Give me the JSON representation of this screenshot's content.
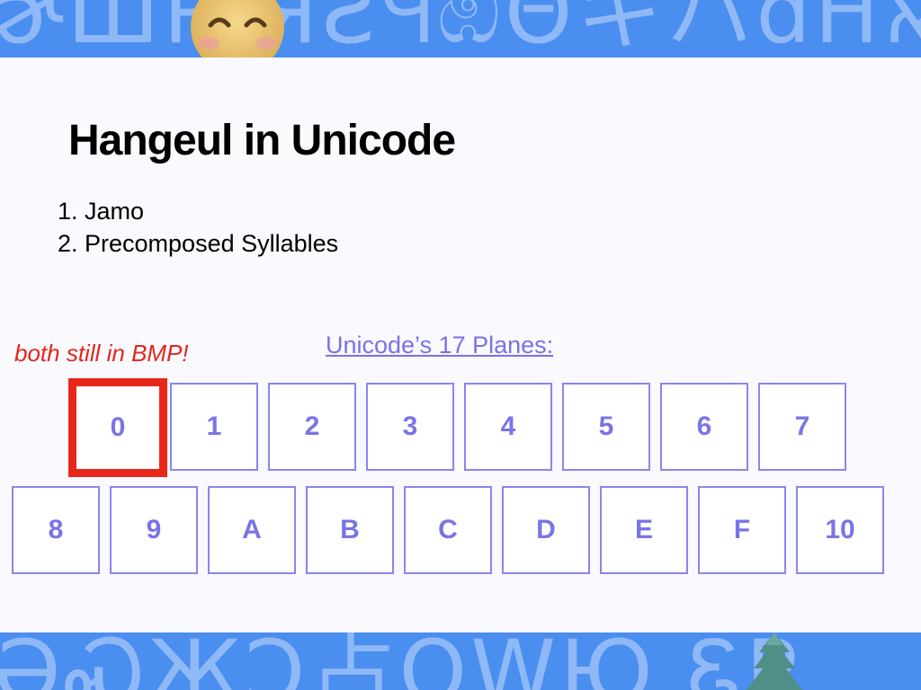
{
  "slide": {
    "title": "Hangeul in Unicode",
    "list": [
      "1. Jamo",
      "2. Precomposed Syllables"
    ],
    "note": "both still in BMP!",
    "planes_link": "Unicode’s 17 Planes:",
    "planes_row1": [
      "0",
      "1",
      "2",
      "3",
      "4",
      "5",
      "6",
      "7"
    ],
    "planes_row2": [
      "8",
      "9",
      "A",
      "B",
      "C",
      "D",
      "E",
      "F",
      "10"
    ],
    "highlighted_plane": "0"
  },
  "decor": {
    "top_glyphs": "ɚШȐ ЯƧႷඹΘキハƌHא",
    "bottom_glyphs": "ƏᏍЖƆ占ȮŴЮ ᏋР",
    "band_color": "#4a8ef0",
    "glyph_color": "#8fb8f6",
    "icons": [
      "smiling-face-emoji",
      "tree-emoji"
    ]
  },
  "colors": {
    "highlight": "#e8271b",
    "box_text": "#7a74e6",
    "link": "#7a72e6",
    "note": "#e2261b"
  }
}
